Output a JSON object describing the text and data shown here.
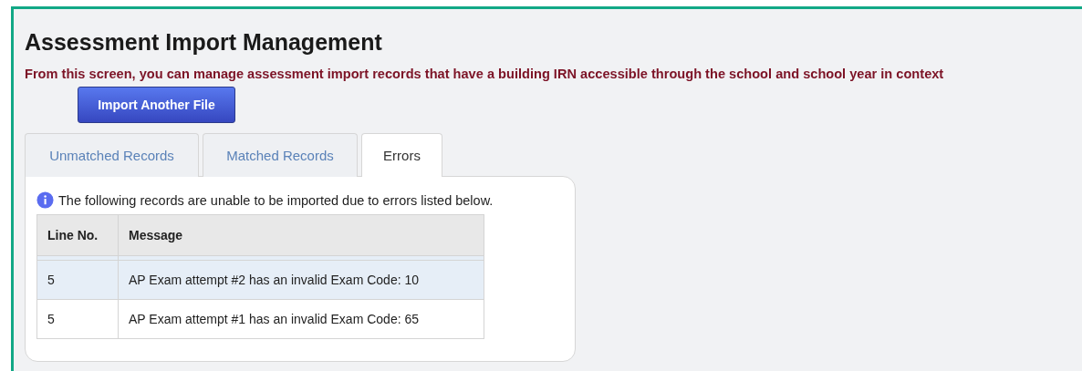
{
  "page": {
    "title": "Assessment Import Management",
    "description": "From this screen, you can manage assessment import records that have a building IRN accessible through the school and school year in context"
  },
  "import_button": {
    "label": "Import Another File"
  },
  "tabs": [
    {
      "label": "Unmatched Records",
      "selected": false
    },
    {
      "label": "Matched Records",
      "selected": false
    },
    {
      "label": "Errors",
      "selected": true
    }
  ],
  "notice": "The following records are unable to be imported due to errors listed below.",
  "table": {
    "columns": [
      "Line No.",
      "Message"
    ],
    "rows": [
      {
        "cells": [
          "5",
          "AP Exam attempt #2 has an invalid Exam Code: 10"
        ],
        "selected": true
      },
      {
        "cells": [
          "5",
          "AP Exam attempt #1 has an invalid Exam Code: 65"
        ],
        "selected": false
      }
    ]
  }
}
